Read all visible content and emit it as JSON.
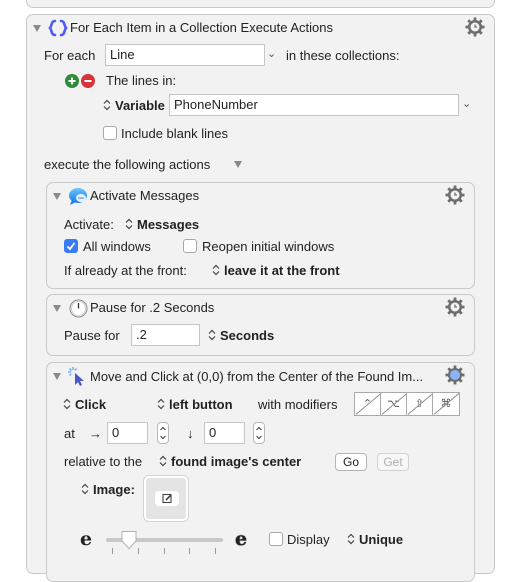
{
  "for_each_action": {
    "title": "For Each Item in a Collection Execute Actions",
    "for_each_label": "For each",
    "for_each_value": "Line",
    "in_collections_label": "in these collections:",
    "lines_in_label": "The lines in:",
    "source_type": "Variable",
    "variable_value": "PhoneNumber",
    "include_blank_lines_label": "Include blank lines",
    "include_blank_lines_checked": false,
    "execute_label": "execute the following actions",
    "icon": "braces-icon",
    "accent_color": "#4f5bf2"
  },
  "activate_action": {
    "title": "Activate Messages",
    "activate_label": "Activate:",
    "app_value": "Messages",
    "all_windows_label": "All windows",
    "all_windows_checked": true,
    "reopen_label": "Reopen initial windows",
    "reopen_checked": false,
    "if_front_label": "If already at the front:",
    "if_front_value": "leave it at the front",
    "icon": "messages-icon"
  },
  "pause_action": {
    "title": "Pause for .2 Seconds",
    "pause_label": "Pause for",
    "pause_value": ".2",
    "unit_value": "Seconds",
    "icon": "clock-icon"
  },
  "click_action": {
    "title": "Move and Click at (0,0) from the Center of the Found Im...",
    "click_type": "Click",
    "button_value": "left button",
    "modifiers_label": "with modifiers",
    "modifiers": [
      "⌃",
      "⌥",
      "⇧",
      "⌘"
    ],
    "at_label": "at",
    "x_arrow": "→",
    "x_value": "0",
    "y_arrow": "↓",
    "y_value": "0",
    "relative_label": "relative to the",
    "relative_value": "found image's center",
    "go_label": "Go",
    "get_label": "Get",
    "image_label": "Image:",
    "fuzz_min_glyph": "e",
    "fuzz_max_glyph": "e",
    "fuzz_level": 0.2,
    "display_label": "Display",
    "display_checked": false,
    "unique_value": "Unique",
    "icon": "cursor-click-icon",
    "gear_color": "#8ab4f8"
  }
}
